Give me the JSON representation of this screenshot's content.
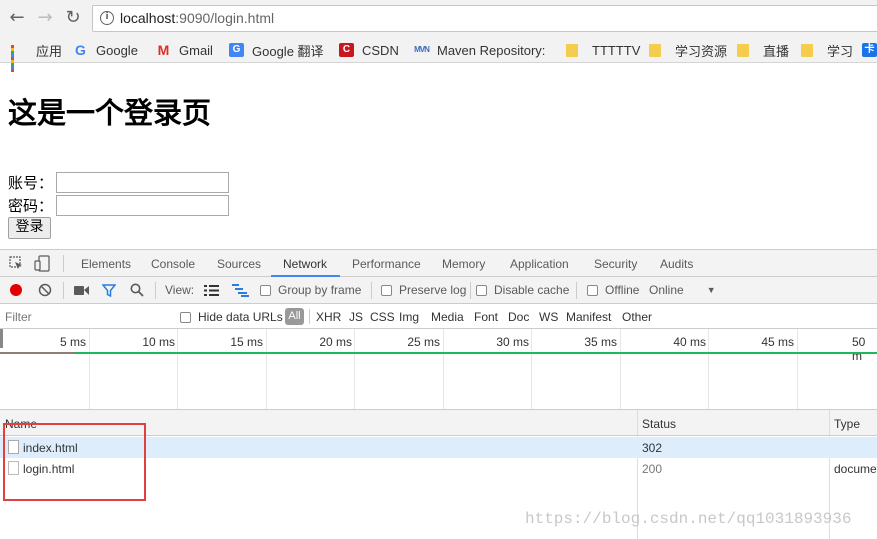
{
  "browser": {
    "url_host": "localhost",
    "url_port_path": ":9090/login.html"
  },
  "bookmarks": [
    {
      "label": "应用",
      "icon": "apps-grid-icon"
    },
    {
      "label": "Google",
      "icon": "google-icon"
    },
    {
      "label": "Gmail",
      "icon": "gmail-icon"
    },
    {
      "label": "Google 翻译",
      "icon": "google-translate-icon"
    },
    {
      "label": "CSDN",
      "icon": "csdn-icon"
    },
    {
      "label": "Maven Repository:",
      "icon": "maven-icon"
    },
    {
      "label": "TTTTTV",
      "icon": "folder-icon"
    },
    {
      "label": "学习资源",
      "icon": "folder-icon"
    },
    {
      "label": "直播",
      "icon": "folder-icon"
    },
    {
      "label": "学习",
      "icon": "folder-icon"
    }
  ],
  "page": {
    "title": "这是一个登录页",
    "account_label": "账号：",
    "password_label": "密码：",
    "login_button": "登录"
  },
  "devtools": {
    "tabs": [
      "Elements",
      "Console",
      "Sources",
      "Network",
      "Performance",
      "Memory",
      "Application",
      "Security",
      "Audits"
    ],
    "active_tab": "Network",
    "controls": {
      "view_label": "View:",
      "group_by_frame": "Group by frame",
      "preserve_log": "Preserve log",
      "disable_cache": "Disable cache",
      "offline": "Offline",
      "online": "Online"
    },
    "filter": {
      "placeholder": "Filter",
      "hide_data_urls": "Hide data URLs",
      "all": "All",
      "types": [
        "XHR",
        "JS",
        "CSS",
        "Img",
        "Media",
        "Font",
        "Doc",
        "WS",
        "Manifest",
        "Other"
      ]
    },
    "timeline_ticks": [
      "5 ms",
      "10 ms",
      "15 ms",
      "20 ms",
      "25 ms",
      "30 ms",
      "35 ms",
      "40 ms",
      "45 ms",
      "50 m"
    ],
    "columns": {
      "name": "Name",
      "status": "Status",
      "type": "Type"
    },
    "requests": [
      {
        "name": "index.html",
        "status": "302",
        "type": ""
      },
      {
        "name": "login.html",
        "status": "200",
        "type": "docume"
      }
    ]
  },
  "watermark": "https://blog.csdn.net/qq1031893936",
  "colors": {
    "devtools_accent": "#4285f4",
    "record_red": "#e20000",
    "timeline_green": "#1eb75a",
    "selected_row": "#deedfb",
    "annotation_red": "#e04040"
  }
}
